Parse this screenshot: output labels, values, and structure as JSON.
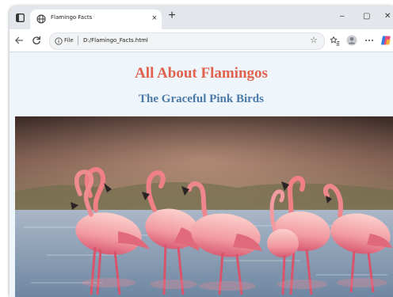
{
  "browser": {
    "tab": {
      "title": "Flamingo Facts",
      "close_glyph": "×"
    },
    "new_tab_glyph": "+",
    "window_controls": {
      "minimize": "–",
      "maximize": "▢",
      "close": "✕"
    },
    "address": {
      "scheme_label": "File",
      "url": "D:/Flamingo_Facts.html",
      "star_glyph": "☆"
    },
    "icons": [
      "tab-actions-icon",
      "globe-icon",
      "back-arrow-icon",
      "reload-icon",
      "info-icon",
      "favorites-icon",
      "profile-icon",
      "more-icon",
      "copilot-icon"
    ]
  },
  "page": {
    "title": "All About Flamingos",
    "subtitle": "The Graceful Pink Birds",
    "colors": {
      "title": "#e0624d",
      "subtitle": "#4a7aa8",
      "background": "#eef5fb"
    }
  }
}
